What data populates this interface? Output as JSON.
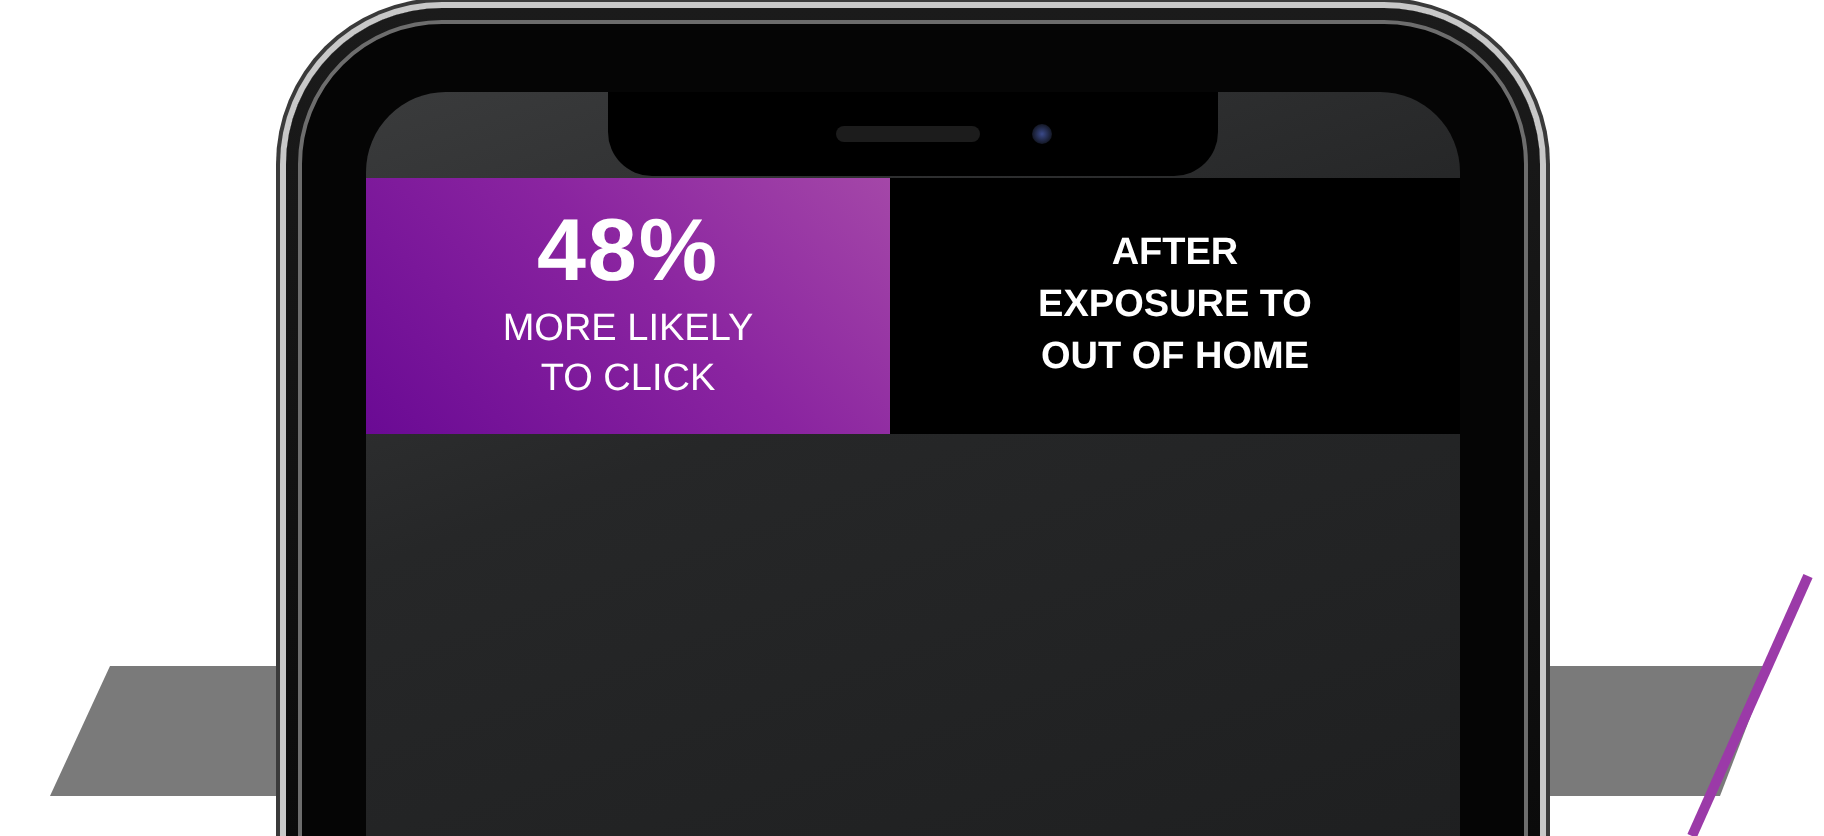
{
  "stat": {
    "value": "48%",
    "caption_lines": [
      "MORE LIKELY",
      "TO CLICK"
    ]
  },
  "context": {
    "lines": [
      "AFTER",
      "EXPOSURE TO",
      "OUT OF HOME"
    ]
  }
}
